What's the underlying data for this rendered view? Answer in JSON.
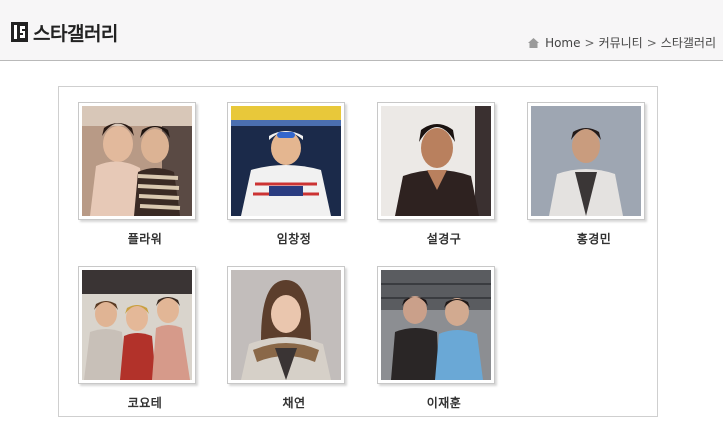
{
  "header": {
    "title": "스타갤러리",
    "breadcrumb": [
      "Home",
      "커뮤니티",
      "스타갤러리"
    ],
    "separator": ">"
  },
  "gallery": {
    "items": [
      {
        "name": "플라워"
      },
      {
        "name": "임창정"
      },
      {
        "name": "설경구"
      },
      {
        "name": "홍경민"
      },
      {
        "name": "코요테"
      },
      {
        "name": "채연"
      },
      {
        "name": "이재훈"
      }
    ]
  }
}
